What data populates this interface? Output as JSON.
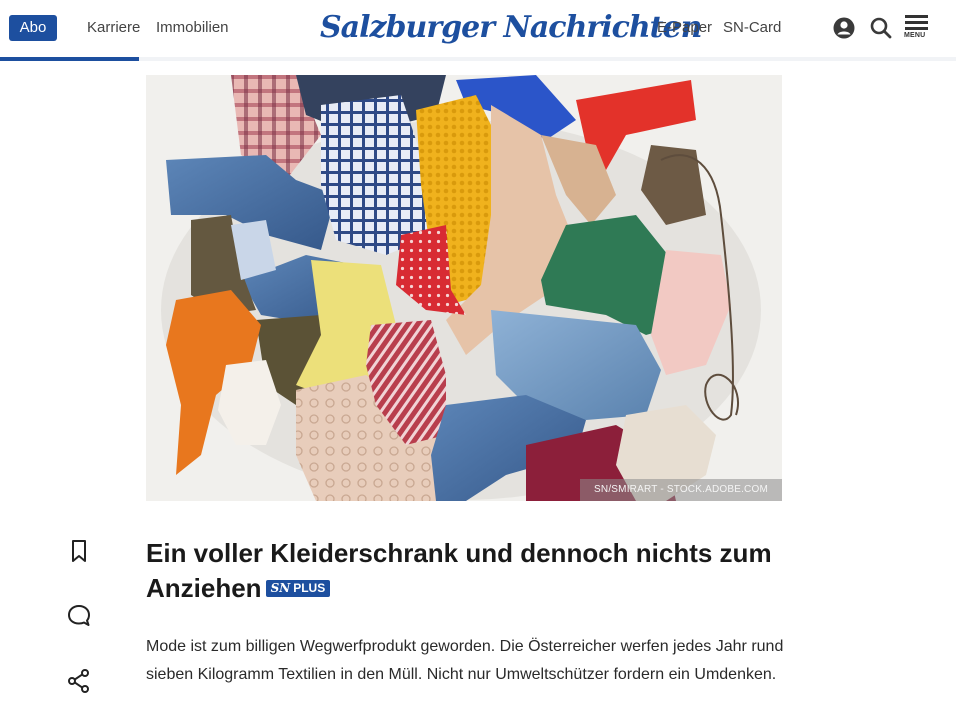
{
  "header": {
    "abo_label": "Abo",
    "nav_left": [
      "Karriere",
      "Immobilien"
    ],
    "logo_text": "Salzburger Nachrichten",
    "nav_right": [
      "E-Paper",
      "SN-Card"
    ],
    "menu_label": "MENU",
    "icons": [
      "account-icon",
      "search-icon",
      "menu-icon"
    ],
    "reading_progress": 0.145
  },
  "hero": {
    "credit": "SN/SMIRART - STOCK.ADOBE.COM"
  },
  "article": {
    "headline": "Ein voller Kleiderschrank und dennoch nichts zum Anziehen",
    "badge_logo": "SN",
    "badge_text": "PLUS",
    "lead": "Mode ist zum billigen Wegwerfprodukt geworden. Die Österreicher werfen jedes Jahr rund sieben Kilogramm Textilien in den Müll. Nicht nur Umweltschützer fordern ein Umdenken."
  },
  "side_actions": [
    "bookmark-icon",
    "comment-icon",
    "share-icon"
  ],
  "colors": {
    "brand": "#1d4f9f",
    "text": "#1a1a1a"
  }
}
